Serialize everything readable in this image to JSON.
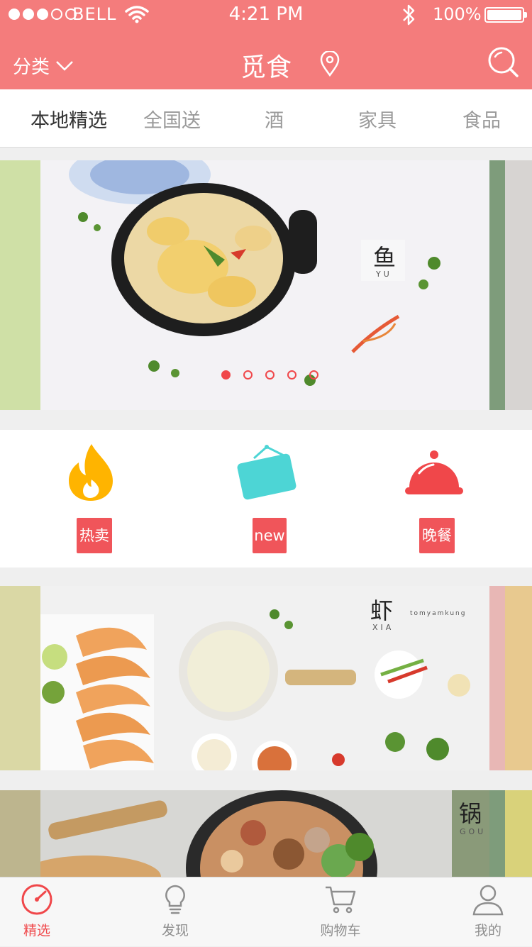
{
  "status_bar": {
    "carrier": "BELL",
    "time": "4:21 PM",
    "battery": "100%",
    "battery_level": 1.0
  },
  "header": {
    "category_label": "分类",
    "title": "觅食"
  },
  "tabs": [
    {
      "label": "本地精选",
      "active": true
    },
    {
      "label": "全国送"
    },
    {
      "label": "酒"
    },
    {
      "label": "家具"
    },
    {
      "label": "食品"
    }
  ],
  "banners": [
    {
      "char": "鱼",
      "sub": "YU",
      "accent_left": "#cfe0a6",
      "accent_right": "#7e9c7b"
    },
    {
      "char": "虾",
      "sub": "XIA",
      "tag": "tomyamkung",
      "accent_left": "#dad8a5",
      "accent_right": "#e8b7b5"
    },
    {
      "char": "锅",
      "sub": "GOU",
      "accent_left": "#bdb58e",
      "accent_right": "#7e9c7b"
    }
  ],
  "carousel": {
    "page_count": 5,
    "active_index": 0
  },
  "categories": [
    {
      "label": "热卖",
      "icon": "flame-icon",
      "color": "#ffb400"
    },
    {
      "label": "new",
      "icon": "sign-board-icon",
      "color": "#4dd5d5"
    },
    {
      "label": "晚餐",
      "icon": "cloche-icon",
      "color": "#f0474a"
    }
  ],
  "tabbar": [
    {
      "label": "精选",
      "icon": "gauge-icon",
      "active": true
    },
    {
      "label": "发现",
      "icon": "lightbulb-icon"
    },
    {
      "label": "购物车",
      "icon": "cart-icon"
    },
    {
      "label": "我的",
      "icon": "user-icon"
    }
  ],
  "colors": {
    "brand": "#f47c7c",
    "accent_red": "#f0474a",
    "label_red": "#f0555a"
  }
}
